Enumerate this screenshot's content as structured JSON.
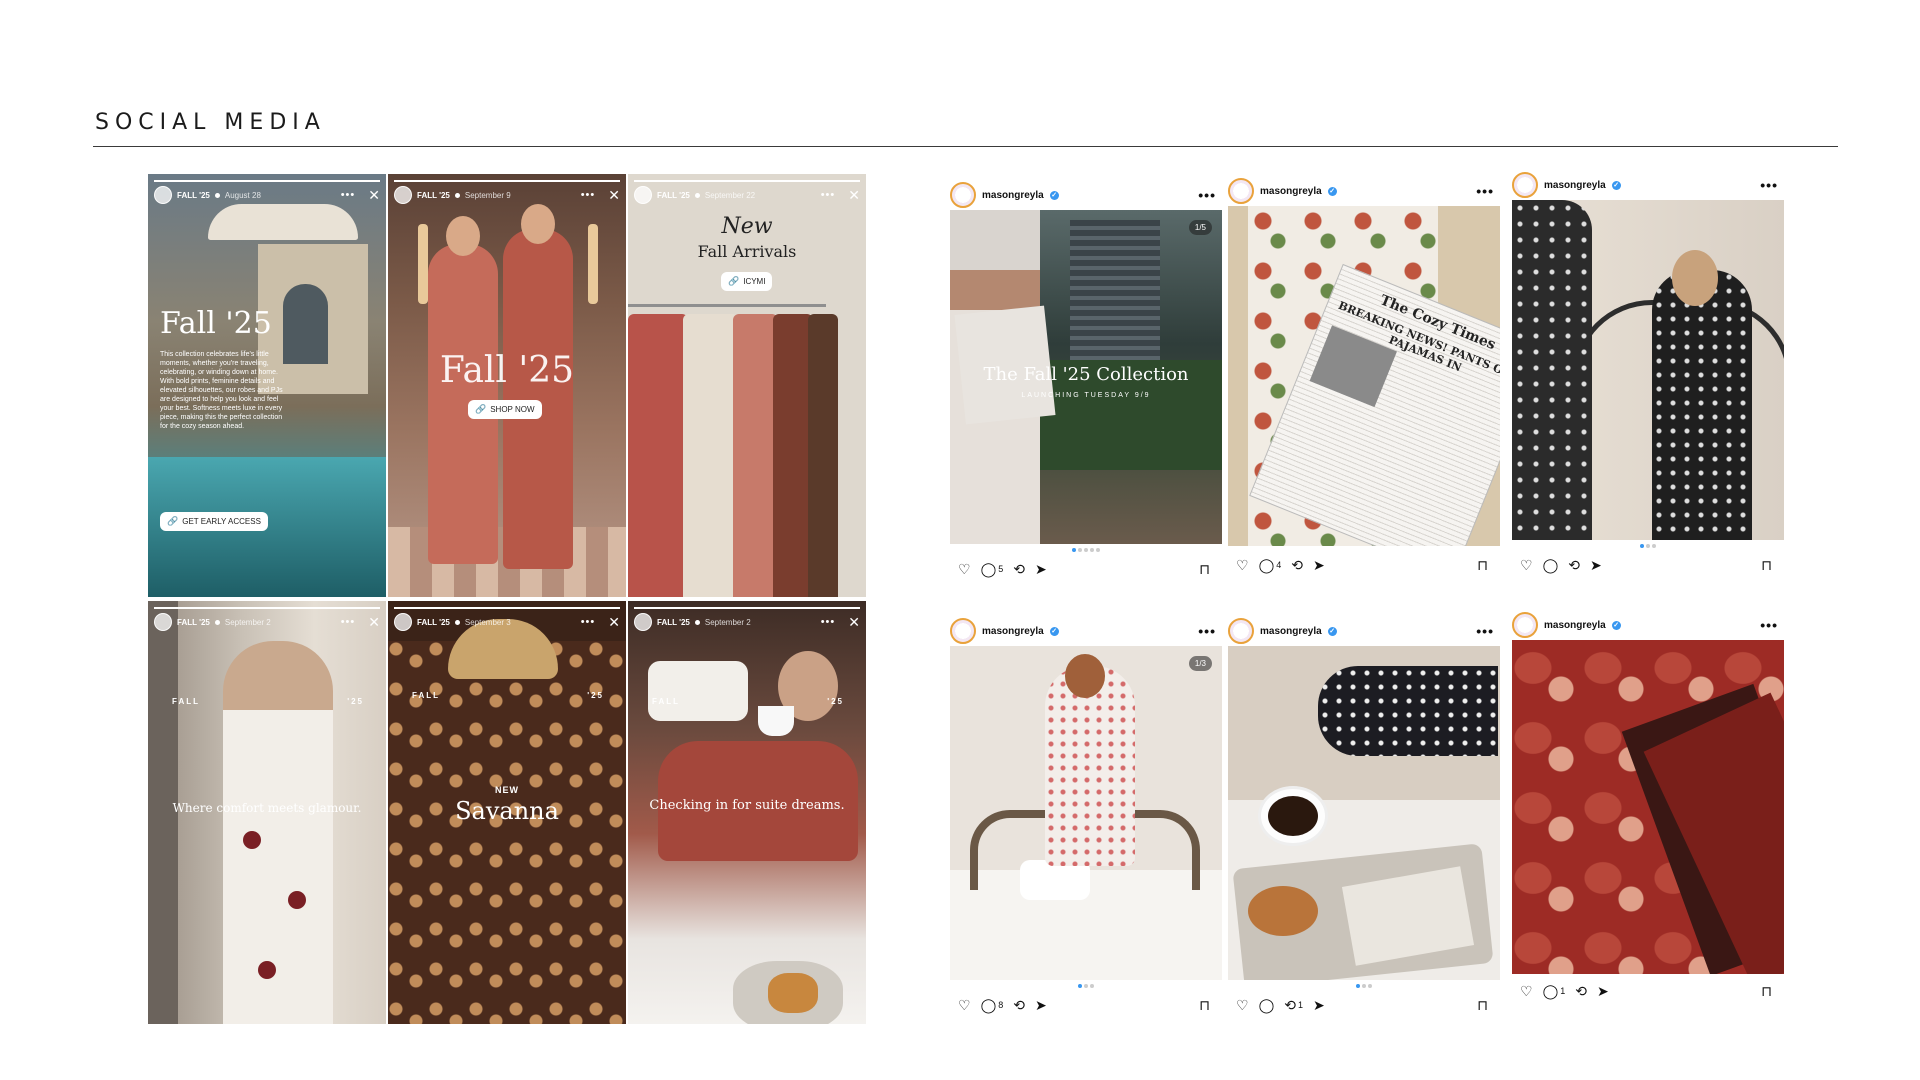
{
  "section": {
    "title": "SOCIAL MEDIA"
  },
  "stories": [
    {
      "account": "FALL '25",
      "date": "August 28",
      "headline": "Fall '25",
      "body": "This collection celebrates life's little moments, whether you're traveling, celebrating, or winding down at home. With bold prints, feminine details and elevated silhouettes, our robes and PJs are designed to help you look and feel your best. Softness meets luxe in every piece, making this the perfect collection for the cozy season ahead.",
      "cta": "GET EARLY ACCESS"
    },
    {
      "account": "FALL '25",
      "date": "September 9",
      "headline": "Fall '25",
      "cta": "SHOP NOW"
    },
    {
      "account": "FALL '25",
      "date": "September 22",
      "line1": "New",
      "line2": "Fall Arrivals",
      "cta": "ICYMI"
    },
    {
      "account": "FALL '25",
      "date": "September 2",
      "tag_left": "FALL",
      "tag_right": "'25",
      "caption": "Where comfort meets glamour."
    },
    {
      "account": "FALL '25",
      "date": "September 3",
      "tag_left": "FALL",
      "tag_right": "'25",
      "new_label": "NEW",
      "name": "Savanna"
    },
    {
      "account": "FALL '25",
      "date": "September 2",
      "tag_left": "FALL",
      "tag_right": "'25",
      "caption": "Checking in for suite dreams."
    }
  ],
  "story_ui": {
    "more": "•••",
    "close": "✕",
    "link_icon": "link-icon"
  },
  "posts": [
    {
      "username": "masongreyla",
      "counter": "1/5",
      "title": "The Fall '25 Collection",
      "subtitle": "LAUNCHING TUESDAY 9/9",
      "comments": "5",
      "reposts": "",
      "dots": 5,
      "active_dot": 0
    },
    {
      "username": "masongreyla",
      "newspaper": "The Cozy Times",
      "headline": "BREAKING NEWS! PANTS OUT, PAJAMAS IN",
      "comments": "4",
      "reposts": ""
    },
    {
      "username": "masongreyla",
      "comments": "",
      "reposts": "",
      "dots": 3,
      "active_dot": 0
    },
    {
      "username": "masongreyla",
      "counter": "1/3",
      "comments": "8",
      "reposts": "",
      "dots": 3,
      "active_dot": 0
    },
    {
      "username": "masongreyla",
      "comments": "",
      "reposts": "1",
      "dots": 3,
      "active_dot": 0
    },
    {
      "username": "masongreyla",
      "comments": "1",
      "reposts": ""
    }
  ],
  "post_ui": {
    "more": "•••",
    "verified": "✓",
    "like": "♡",
    "comment": "◯",
    "repost": "⟲",
    "share": "➤",
    "save": "⊓"
  }
}
